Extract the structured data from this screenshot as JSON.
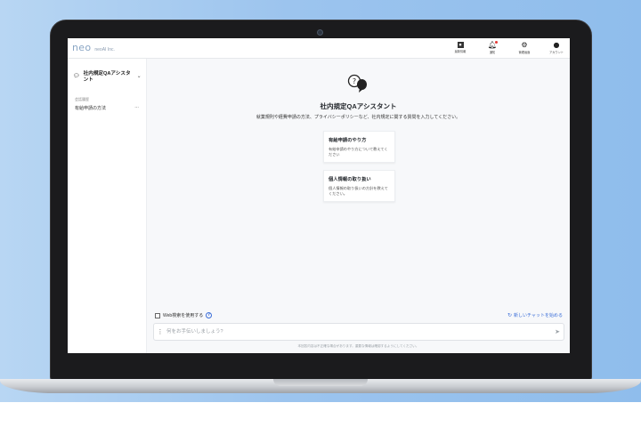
{
  "header": {
    "logo": "neo",
    "company": "neoAI Inc.",
    "nav": [
      {
        "icon": "news-icon",
        "label": "最新情報"
      },
      {
        "icon": "bell-icon",
        "label": "通知"
      },
      {
        "icon": "gear-icon",
        "label": "管理画面"
      },
      {
        "icon": "account-icon",
        "label": "アカウント"
      }
    ]
  },
  "sidebar": {
    "assistant_name": "社内規定QAアシスタント",
    "section_label": "会話履歴",
    "history": [
      {
        "label": "有給申請の方法",
        "more": "···"
      }
    ]
  },
  "main": {
    "title": "社内規定QAアシスタント",
    "subtitle": "就業規則や経費申請の方法、プライバシーポリシーなど、社内規定に関する質問を入力してください。",
    "cards": [
      {
        "title": "有給申請のやり方",
        "desc": "有給申請のやり方について教えてください"
      },
      {
        "title": "個人情報の取り扱い",
        "desc": "個人情報の取り扱いの方針を教えてください。"
      }
    ],
    "web_search_label": "Web検索を使用する",
    "new_chat_label": "新しいチャットを始める",
    "input_placeholder": "何をお手伝いしましょう?",
    "disclaimer": "本回答内容は不正確な場合があります。重要な情報は確認するようにしてください。"
  },
  "colors": {
    "accent": "#3b6ed8",
    "background": "#f7f8fa",
    "sky": "#9cc4ee"
  }
}
